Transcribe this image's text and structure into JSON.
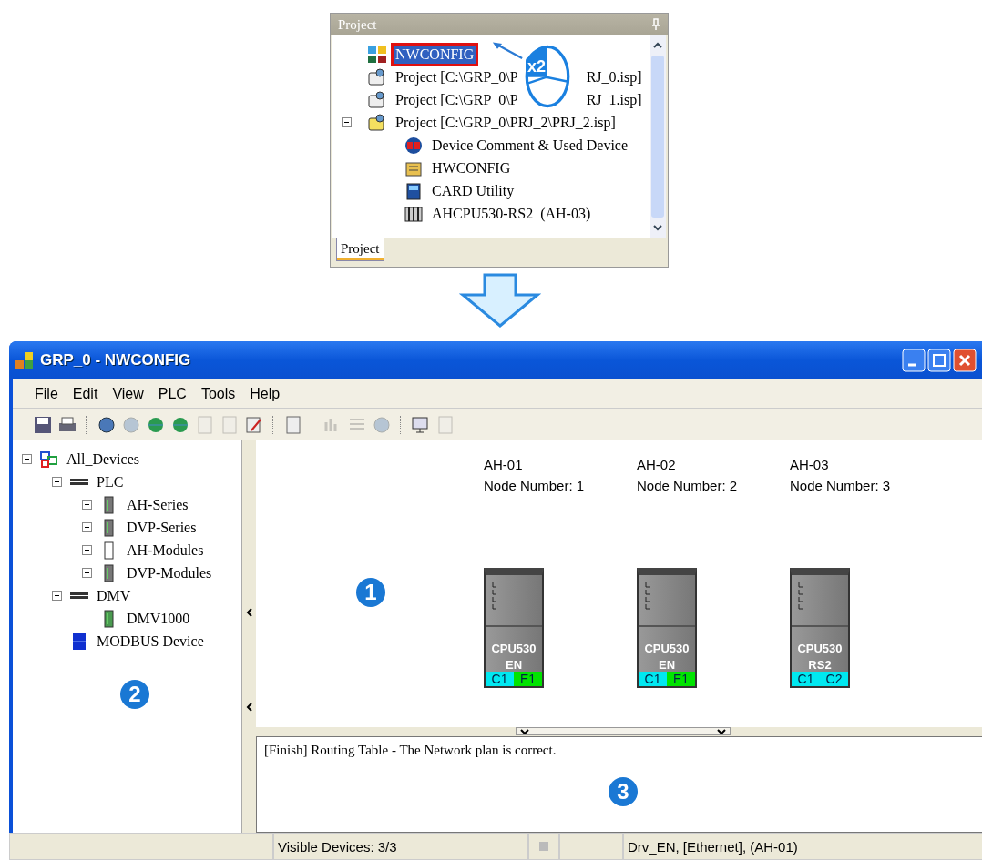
{
  "project_panel": {
    "title": "Project",
    "items": [
      {
        "kind": "network",
        "label": "NWCONFIG",
        "selected": true,
        "annotated": true
      },
      {
        "kind": "project",
        "label": "Project [C:\\GRP_0\\P",
        "label_end": "RJ_0.isp]",
        "selected": false,
        "annotated": false
      },
      {
        "kind": "project",
        "label": "Project [C:\\GRP_0\\P",
        "label_end": "RJ_1.isp]",
        "selected": false,
        "annotated": false
      },
      {
        "kind": "project-open",
        "label": "Project [C:\\GRP_0\\PRJ_2\\PRJ_2.isp]",
        "selected": false,
        "annotated": false,
        "expanded": true,
        "children": [
          {
            "kind": "comment",
            "label": "Device Comment & Used Device",
            "selected": false,
            "annotated": false
          },
          {
            "kind": "hwconfig",
            "label": "HWCONFIG",
            "selected": false,
            "annotated": false
          },
          {
            "kind": "card",
            "label": "CARD Utility",
            "selected": false,
            "annotated": false
          },
          {
            "kind": "rack",
            "label": "AHCPU530-RS2  (AH-03)",
            "selected": false,
            "annotated": false
          }
        ]
      }
    ],
    "click_badge": "x2",
    "tabs": [
      {
        "label": "Project",
        "selected": true
      }
    ]
  },
  "window": {
    "title": "GRP_0 - NWCONFIG"
  },
  "menu": [
    "File",
    "Edit",
    "View",
    "PLC",
    "Tools",
    "Help"
  ],
  "toolbar": [
    {
      "kind": "save",
      "disabled": false
    },
    {
      "kind": "print",
      "disabled": false
    },
    {
      "kind": "sep"
    },
    {
      "kind": "circle",
      "disabled": false
    },
    {
      "kind": "circle",
      "disabled": true
    },
    {
      "kind": "globe",
      "disabled": false
    },
    {
      "kind": "globe",
      "disabled": false
    },
    {
      "kind": "page",
      "disabled": true
    },
    {
      "kind": "page",
      "disabled": true
    },
    {
      "kind": "edit",
      "disabled": false
    },
    {
      "kind": "sep"
    },
    {
      "kind": "page",
      "disabled": false
    },
    {
      "kind": "sep"
    },
    {
      "kind": "chart",
      "disabled": true
    },
    {
      "kind": "list",
      "disabled": true
    },
    {
      "kind": "circle",
      "disabled": true
    },
    {
      "kind": "sep"
    },
    {
      "kind": "monitor",
      "disabled": false
    },
    {
      "kind": "page",
      "disabled": true
    }
  ],
  "device_tree": [
    {
      "kind": "all",
      "label": "All_Devices",
      "expanded": true,
      "children": [
        {
          "kind": "group",
          "label": "PLC",
          "expanded": true,
          "children": [
            {
              "kind": "ah",
              "label": "AH-Series",
              "expanded": false
            },
            {
              "kind": "dvp",
              "label": "DVP-Series",
              "expanded": false
            },
            {
              "kind": "module",
              "label": "AH-Modules",
              "expanded": false
            },
            {
              "kind": "dvp",
              "label": "DVP-Modules",
              "expanded": false
            }
          ]
        },
        {
          "kind": "group",
          "label": "DMV",
          "expanded": true,
          "children": [
            {
              "kind": "dmv",
              "label": "DMV1000"
            }
          ]
        },
        {
          "kind": "modbus",
          "label": "MODBUS Device"
        }
      ]
    }
  ],
  "devices": [
    {
      "name": "AH-01",
      "node": "Node Number: 1",
      "model": [
        "CPU530",
        "EN"
      ],
      "ports": [
        {
          "label": "C1",
          "color": "#00e8f0"
        },
        {
          "label": "E1",
          "color": "#00e400"
        }
      ]
    },
    {
      "name": "AH-02",
      "node": "Node Number: 2",
      "model": [
        "CPU530",
        "EN"
      ],
      "ports": [
        {
          "label": "C1",
          "color": "#00e8f0"
        },
        {
          "label": "E1",
          "color": "#00e400"
        }
      ]
    },
    {
      "name": "AH-03",
      "node": "Node Number: 3",
      "model": [
        "CPU530",
        "RS2"
      ],
      "ports": [
        {
          "label": "C1",
          "color": "#00e8f0"
        },
        {
          "label": "C2",
          "color": "#00e8f0"
        }
      ]
    }
  ],
  "output": {
    "message": "[Finish] Routing Table - The Network plan is correct."
  },
  "callouts": {
    "canvas": "1",
    "tree": "2",
    "output": "3"
  },
  "status_bar": [
    "Visible Devices: 3/3",
    "Drv_EN, [Ethernet], (AH-01)"
  ]
}
